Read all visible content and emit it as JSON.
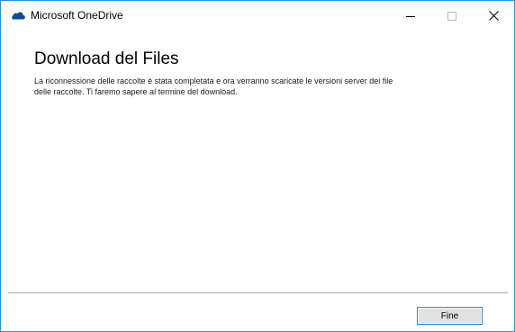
{
  "window": {
    "title": "Microsoft OneDrive",
    "app_icon": "onedrive-cloud-icon",
    "controls": [
      "minimize-icon",
      "maximize-icon",
      "close-icon"
    ]
  },
  "main": {
    "heading": "Download del Files",
    "message": "La riconnessione delle raccolte è stata completata e ora verranno scaricate le versioni server dei file delle raccolte. Ti faremo sapere al termine del download."
  },
  "footer": {
    "finish_label": "Fine"
  },
  "colors": {
    "accent": "#2b8fd6",
    "onedrive_blue": "#0a4b9a",
    "button_bg": "#e1e1e1"
  }
}
